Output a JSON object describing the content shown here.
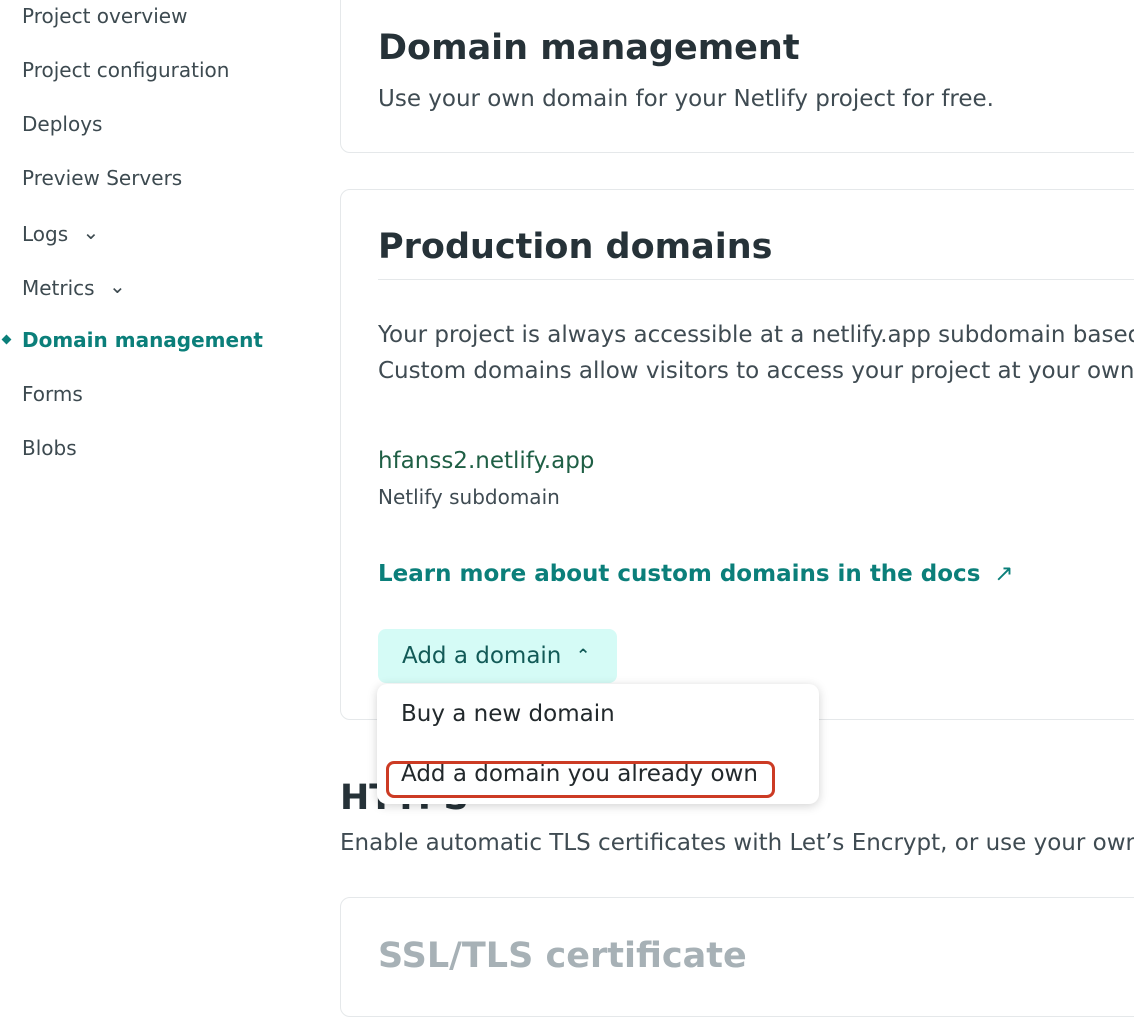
{
  "sidebar": {
    "items": [
      {
        "label": "Project overview"
      },
      {
        "label": "Project configuration"
      },
      {
        "label": "Deploys"
      },
      {
        "label": "Preview Servers"
      },
      {
        "label": "Logs"
      },
      {
        "label": "Metrics"
      },
      {
        "label": "Domain management"
      },
      {
        "label": "Forms"
      },
      {
        "label": "Blobs"
      }
    ],
    "chevron": "⌄"
  },
  "domain_management": {
    "title": "Domain management",
    "description": "Use your own domain for your Netlify project for free."
  },
  "production_domains": {
    "title": "Production domains",
    "description_line1": "Your project is always accessible at a netlify.app subdomain based",
    "description_line2": "Custom domains allow visitors to access your project at your own",
    "subdomain_name": "hfanss2.netlify.app",
    "subdomain_label": "Netlify subdomain",
    "learn_more_link": "Learn more about custom domains in the docs",
    "external_link_icon": "↗",
    "add_domain_button": "Add a domain",
    "button_chevron": "⌃"
  },
  "dropdown": {
    "items": [
      {
        "label": "Buy a new domain"
      },
      {
        "label": "Add a domain you already own"
      }
    ]
  },
  "https": {
    "title": "HTTPS",
    "description": "Enable automatic TLS certificates with Let’s Encrypt, or use your own c"
  },
  "ssl_tls": {
    "title": "SSL/TLS certificate"
  },
  "colors": {
    "accent": "#0b7f7a",
    "button_background": "#d5fbf6",
    "highlight_outline": "#cc3b24",
    "muted_text": "#a7b1b6"
  }
}
